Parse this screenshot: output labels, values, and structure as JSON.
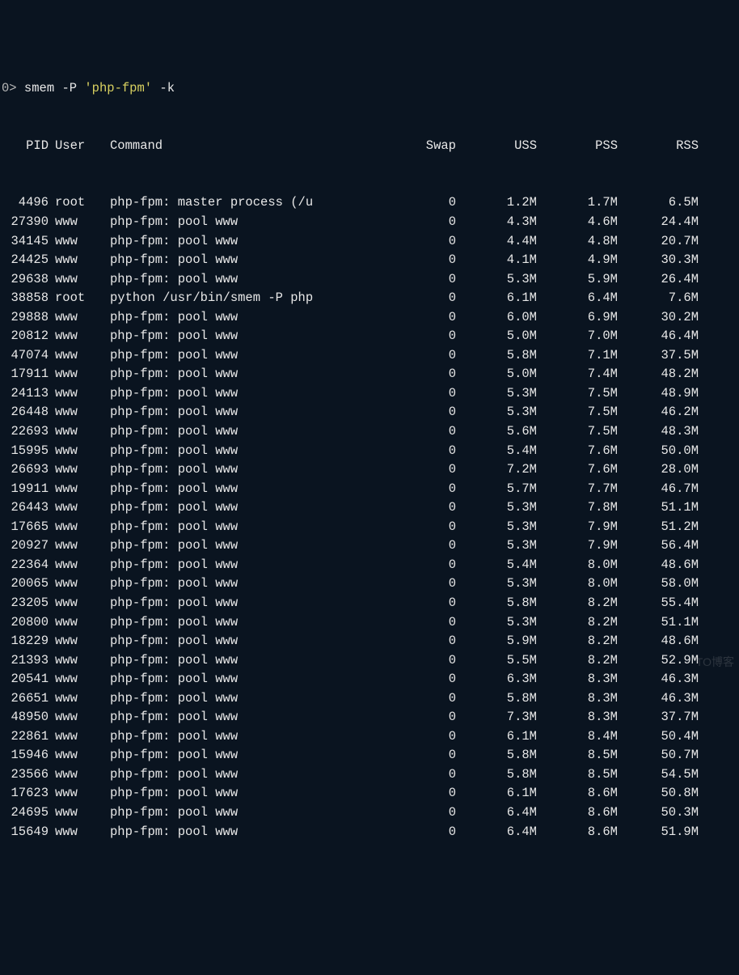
{
  "prompt": {
    "prefix": "0>",
    "command": "smem",
    "flag1": "-P",
    "arg": "'php-fpm'",
    "flag2": "-k"
  },
  "headers": {
    "pid": "PID",
    "user": "User",
    "command": "Command",
    "swap": "Swap",
    "uss": "USS",
    "pss": "PSS",
    "rss": "RSS"
  },
  "rows": [
    {
      "pid": "4496",
      "user": "root",
      "cmd": "php-fpm: master process (/u",
      "swap": "0",
      "uss": "1.2M",
      "pss": "1.7M",
      "rss": "6.5M"
    },
    {
      "pid": "27390",
      "user": "www",
      "cmd": "php-fpm: pool www",
      "swap": "0",
      "uss": "4.3M",
      "pss": "4.6M",
      "rss": "24.4M"
    },
    {
      "pid": "34145",
      "user": "www",
      "cmd": "php-fpm: pool www",
      "swap": "0",
      "uss": "4.4M",
      "pss": "4.8M",
      "rss": "20.7M"
    },
    {
      "pid": "24425",
      "user": "www",
      "cmd": "php-fpm: pool www",
      "swap": "0",
      "uss": "4.1M",
      "pss": "4.9M",
      "rss": "30.3M"
    },
    {
      "pid": "29638",
      "user": "www",
      "cmd": "php-fpm: pool www",
      "swap": "0",
      "uss": "5.3M",
      "pss": "5.9M",
      "rss": "26.4M"
    },
    {
      "pid": "38858",
      "user": "root",
      "cmd": "python /usr/bin/smem -P php",
      "swap": "0",
      "uss": "6.1M",
      "pss": "6.4M",
      "rss": "7.6M"
    },
    {
      "pid": "29888",
      "user": "www",
      "cmd": "php-fpm: pool www",
      "swap": "0",
      "uss": "6.0M",
      "pss": "6.9M",
      "rss": "30.2M"
    },
    {
      "pid": "20812",
      "user": "www",
      "cmd": "php-fpm: pool www",
      "swap": "0",
      "uss": "5.0M",
      "pss": "7.0M",
      "rss": "46.4M"
    },
    {
      "pid": "47074",
      "user": "www",
      "cmd": "php-fpm: pool www",
      "swap": "0",
      "uss": "5.8M",
      "pss": "7.1M",
      "rss": "37.5M"
    },
    {
      "pid": "17911",
      "user": "www",
      "cmd": "php-fpm: pool www",
      "swap": "0",
      "uss": "5.0M",
      "pss": "7.4M",
      "rss": "48.2M"
    },
    {
      "pid": "24113",
      "user": "www",
      "cmd": "php-fpm: pool www",
      "swap": "0",
      "uss": "5.3M",
      "pss": "7.5M",
      "rss": "48.9M"
    },
    {
      "pid": "26448",
      "user": "www",
      "cmd": "php-fpm: pool www",
      "swap": "0",
      "uss": "5.3M",
      "pss": "7.5M",
      "rss": "46.2M"
    },
    {
      "pid": "22693",
      "user": "www",
      "cmd": "php-fpm: pool www",
      "swap": "0",
      "uss": "5.6M",
      "pss": "7.5M",
      "rss": "48.3M"
    },
    {
      "pid": "15995",
      "user": "www",
      "cmd": "php-fpm: pool www",
      "swap": "0",
      "uss": "5.4M",
      "pss": "7.6M",
      "rss": "50.0M"
    },
    {
      "pid": "26693",
      "user": "www",
      "cmd": "php-fpm: pool www",
      "swap": "0",
      "uss": "7.2M",
      "pss": "7.6M",
      "rss": "28.0M"
    },
    {
      "pid": "19911",
      "user": "www",
      "cmd": "php-fpm: pool www",
      "swap": "0",
      "uss": "5.7M",
      "pss": "7.7M",
      "rss": "46.7M"
    },
    {
      "pid": "26443",
      "user": "www",
      "cmd": "php-fpm: pool www",
      "swap": "0",
      "uss": "5.3M",
      "pss": "7.8M",
      "rss": "51.1M"
    },
    {
      "pid": "17665",
      "user": "www",
      "cmd": "php-fpm: pool www",
      "swap": "0",
      "uss": "5.3M",
      "pss": "7.9M",
      "rss": "51.2M"
    },
    {
      "pid": "20927",
      "user": "www",
      "cmd": "php-fpm: pool www",
      "swap": "0",
      "uss": "5.3M",
      "pss": "7.9M",
      "rss": "56.4M"
    },
    {
      "pid": "22364",
      "user": "www",
      "cmd": "php-fpm: pool www",
      "swap": "0",
      "uss": "5.4M",
      "pss": "8.0M",
      "rss": "48.6M"
    },
    {
      "pid": "20065",
      "user": "www",
      "cmd": "php-fpm: pool www",
      "swap": "0",
      "uss": "5.3M",
      "pss": "8.0M",
      "rss": "58.0M"
    },
    {
      "pid": "23205",
      "user": "www",
      "cmd": "php-fpm: pool www",
      "swap": "0",
      "uss": "5.8M",
      "pss": "8.2M",
      "rss": "55.4M"
    },
    {
      "pid": "20800",
      "user": "www",
      "cmd": "php-fpm: pool www",
      "swap": "0",
      "uss": "5.3M",
      "pss": "8.2M",
      "rss": "51.1M"
    },
    {
      "pid": "18229",
      "user": "www",
      "cmd": "php-fpm: pool www",
      "swap": "0",
      "uss": "5.9M",
      "pss": "8.2M",
      "rss": "48.6M"
    },
    {
      "pid": "21393",
      "user": "www",
      "cmd": "php-fpm: pool www",
      "swap": "0",
      "uss": "5.5M",
      "pss": "8.2M",
      "rss": "52.9M"
    },
    {
      "pid": "20541",
      "user": "www",
      "cmd": "php-fpm: pool www",
      "swap": "0",
      "uss": "6.3M",
      "pss": "8.3M",
      "rss": "46.3M"
    },
    {
      "pid": "26651",
      "user": "www",
      "cmd": "php-fpm: pool www",
      "swap": "0",
      "uss": "5.8M",
      "pss": "8.3M",
      "rss": "46.3M"
    },
    {
      "pid": "48950",
      "user": "www",
      "cmd": "php-fpm: pool www",
      "swap": "0",
      "uss": "7.3M",
      "pss": "8.3M",
      "rss": "37.7M"
    },
    {
      "pid": "22861",
      "user": "www",
      "cmd": "php-fpm: pool www",
      "swap": "0",
      "uss": "6.1M",
      "pss": "8.4M",
      "rss": "50.4M"
    },
    {
      "pid": "15946",
      "user": "www",
      "cmd": "php-fpm: pool www",
      "swap": "0",
      "uss": "5.8M",
      "pss": "8.5M",
      "rss": "50.7M"
    },
    {
      "pid": "23566",
      "user": "www",
      "cmd": "php-fpm: pool www",
      "swap": "0",
      "uss": "5.8M",
      "pss": "8.5M",
      "rss": "54.5M"
    },
    {
      "pid": "17623",
      "user": "www",
      "cmd": "php-fpm: pool www",
      "swap": "0",
      "uss": "6.1M",
      "pss": "8.6M",
      "rss": "50.8M"
    },
    {
      "pid": "24695",
      "user": "www",
      "cmd": "php-fpm: pool www",
      "swap": "0",
      "uss": "6.4M",
      "pss": "8.6M",
      "rss": "50.3M"
    },
    {
      "pid": "15649",
      "user": "www",
      "cmd": "php-fpm: pool www",
      "swap": "0",
      "uss": "6.4M",
      "pss": "8.6M",
      "rss": "51.9M"
    }
  ],
  "watermark": "TO博客"
}
